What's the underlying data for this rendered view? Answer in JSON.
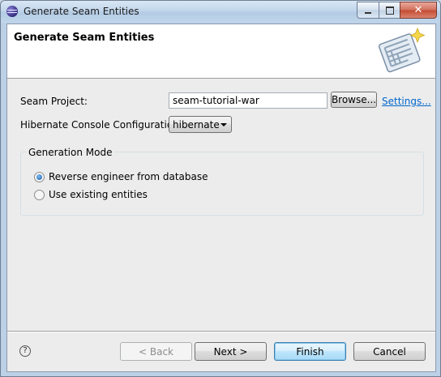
{
  "window": {
    "title": "Generate Seam Entities",
    "controls": {
      "minimize": "minimize-icon",
      "maximize": "maximize-icon",
      "close": "✕"
    }
  },
  "header": {
    "title": "Generate Seam Entities",
    "icon": "seam-wizard-icon"
  },
  "form": {
    "seam_project_label": "Seam Project:",
    "seam_project_value": "seam-tutorial-war",
    "browse_label": "Browse...",
    "settings_label": "Settings...",
    "hibernate_label": "Hibernate Console Configuration:",
    "hibernate_value": "hibernate"
  },
  "generation": {
    "legend": "Generation Mode",
    "options": [
      {
        "label": "Reverse engineer from database",
        "checked": true
      },
      {
        "label": "Use existing entities",
        "checked": false
      }
    ]
  },
  "footer": {
    "help": "?",
    "back_label": "< Back",
    "next_label": "Next >",
    "finish_label": "Finish",
    "cancel_label": "Cancel"
  },
  "colors": {
    "link": "#0066cc",
    "window_frame": "#bcd0e6",
    "dialog_bg": "#ececec"
  }
}
